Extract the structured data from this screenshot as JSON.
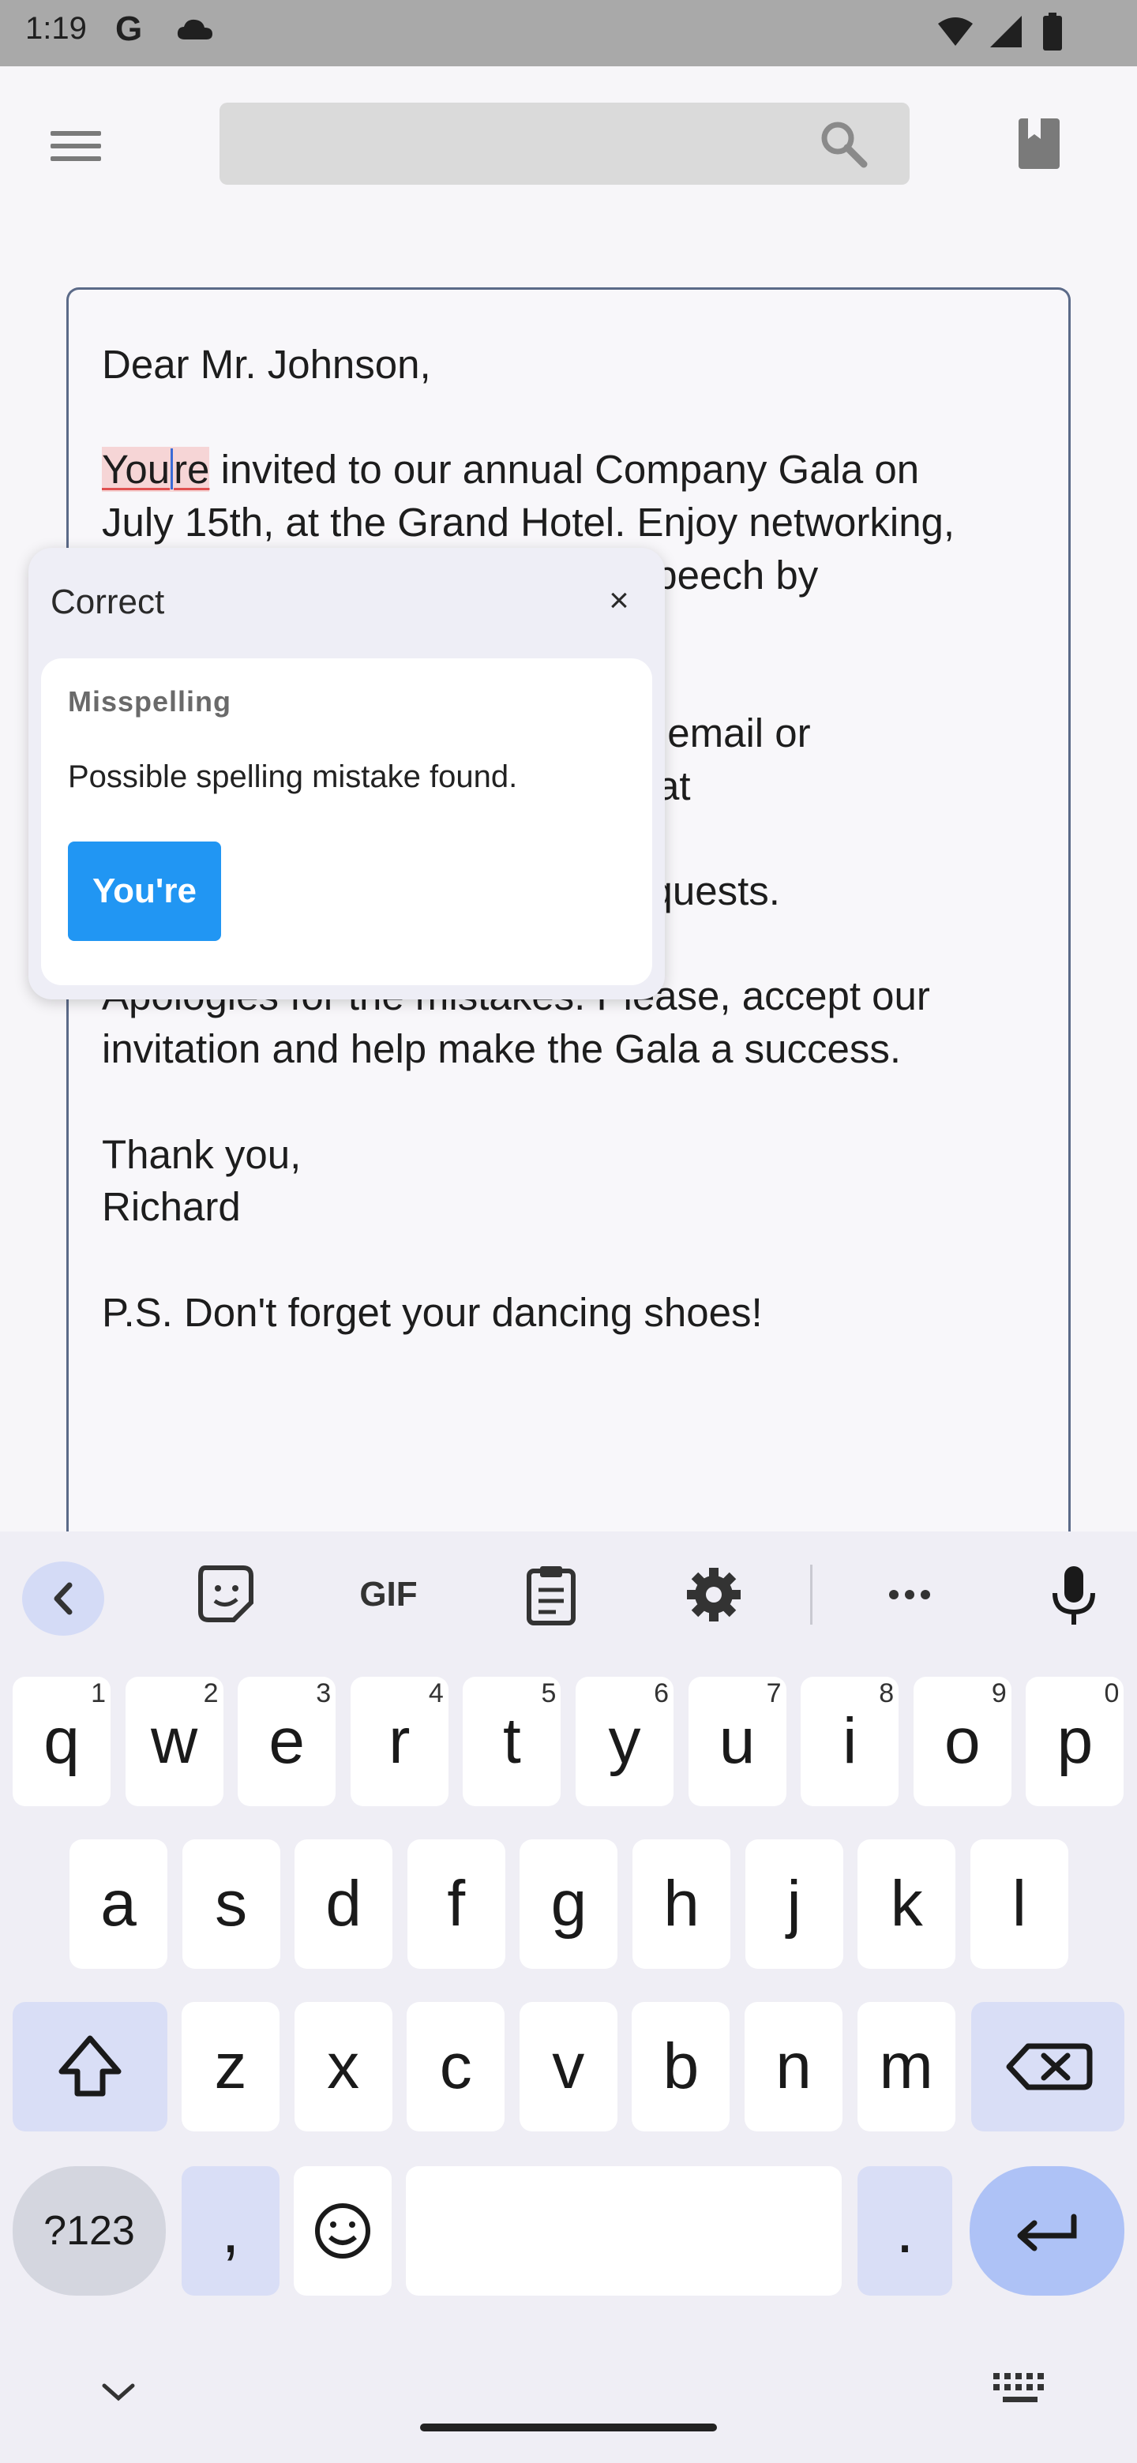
{
  "status": {
    "time": "1:19",
    "g_logo": "G",
    "icons": [
      "cloud-icon",
      "wifi-icon",
      "signal-icon",
      "battery-icon"
    ]
  },
  "appbar": {
    "search_placeholder": "",
    "icons": [
      "menu-icon",
      "search-icon",
      "bookmark-icon"
    ]
  },
  "editor": {
    "misspelled_word": "Youre",
    "misspelled_before_caret": "You",
    "misspelled_after_caret": "re",
    "greeting": "Dear Mr. Johnson,",
    "para1_rest": " invited to our annual Company Gala on\nJuly 15th, at the Grand Hotel. Enjoy networking,\ndelicious food, and a keynote speech by\nour CEO, Thomas Harrison.",
    "para2": "Kindly RSVP by replying to this email or\nby contacting Ms. Sarah Davis at\n(555) 123-4567. Let us know of\nany dietary needs or special requests.",
    "para3": "Apologies for the mistakes. Please, accept our\ninvitation and help make the Gala a success.",
    "closing": "Thank you,\nRichard",
    "ps": "P.S. Don't forget your dancing shoes!"
  },
  "popup": {
    "title": "Correct",
    "close_label": "×",
    "category": "Misspelling",
    "message": "Possible spelling mistake found.",
    "suggestion": "You're"
  },
  "keyboard": {
    "toolbar_icons": [
      "back-icon",
      "sticker-icon",
      "gif-icon",
      "clipboard-icon",
      "settings-icon",
      "more-icon",
      "mic-icon"
    ],
    "gif_label": "GIF",
    "row1": [
      {
        "key": "q",
        "hint": "1"
      },
      {
        "key": "w",
        "hint": "2"
      },
      {
        "key": "e",
        "hint": "3"
      },
      {
        "key": "r",
        "hint": "4"
      },
      {
        "key": "t",
        "hint": "5"
      },
      {
        "key": "y",
        "hint": "6"
      },
      {
        "key": "u",
        "hint": "7"
      },
      {
        "key": "i",
        "hint": "8"
      },
      {
        "key": "o",
        "hint": "9"
      },
      {
        "key": "p",
        "hint": "0"
      }
    ],
    "row2": [
      "a",
      "s",
      "d",
      "f",
      "g",
      "h",
      "j",
      "k",
      "l"
    ],
    "row3": [
      "z",
      "x",
      "c",
      "v",
      "b",
      "n",
      "m"
    ],
    "symbols_label": "?123",
    "comma_label": ",",
    "period_label": "."
  }
}
